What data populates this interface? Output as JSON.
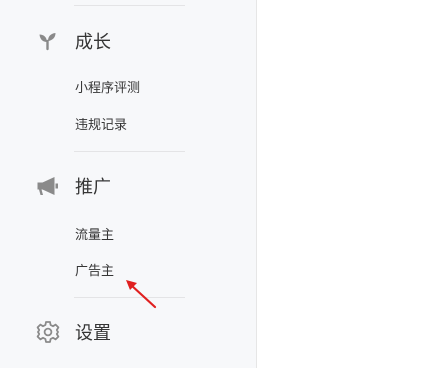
{
  "sidebar": {
    "sections": [
      {
        "label": "成长",
        "icon": "sprout-icon",
        "items": [
          "小程序评测",
          "违规记录"
        ]
      },
      {
        "label": "推广",
        "icon": "megaphone-icon",
        "items": [
          "流量主",
          "广告主"
        ]
      },
      {
        "label": "设置",
        "icon": "gear-icon",
        "items": []
      }
    ]
  },
  "colors": {
    "sidebar_bg": "#f7f8fa",
    "content_bg": "#ffffff",
    "text": "#353535",
    "icon": "#8a8a8a",
    "divider": "#e4e4e6",
    "annotation_arrow": "#e02020"
  }
}
